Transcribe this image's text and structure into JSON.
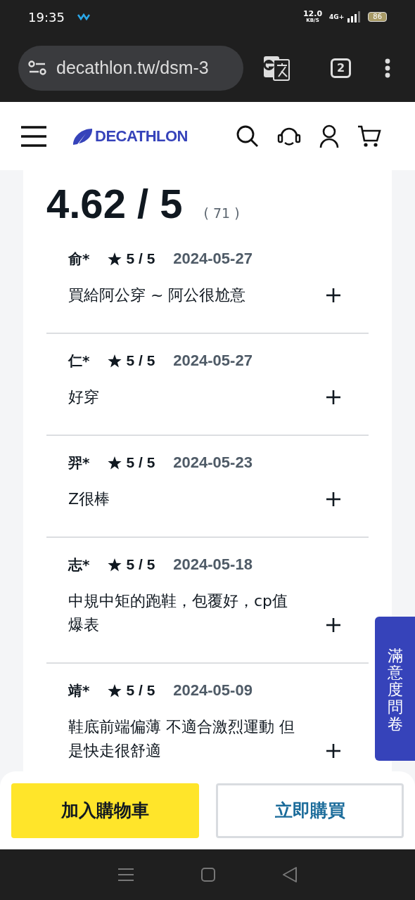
{
  "status_bar": {
    "time": "19:35",
    "speed": "12.0",
    "speed_unit": "KB/S",
    "network": "4G+",
    "battery": "86"
  },
  "browser": {
    "url": "decathlon.tw/dsm-3",
    "tab_count": "2"
  },
  "header": {
    "logo": "DECATHLON"
  },
  "rating": {
    "score": "4.62 / 5",
    "count": "( 71 )"
  },
  "reviews": [
    {
      "author": "俞*",
      "rating": "5 / 5",
      "date": "2024-05-27",
      "text": "買給阿公穿 ~ 阿公很尬意",
      "expanded": false
    },
    {
      "author": "仁*",
      "rating": "5 / 5",
      "date": "2024-05-27",
      "text": "好穿",
      "expanded": false
    },
    {
      "author": "羿*",
      "rating": "5 / 5",
      "date": "2024-05-23",
      "text": "Z很棒",
      "expanded": false
    },
    {
      "author": "志*",
      "rating": "5 / 5",
      "date": "2024-05-18",
      "text": "中規中矩的跑鞋，包覆好，cp值爆表",
      "expanded": false
    },
    {
      "author": "靖*",
      "rating": "5 / 5",
      "date": "2024-05-09",
      "text": "鞋底前端偏薄 不適合激烈運動 但是快走很舒適",
      "expanded": false
    }
  ],
  "survey_tab": "滿意度問卷",
  "actions": {
    "add_to_cart": "加入購物車",
    "buy_now": "立即購買"
  }
}
